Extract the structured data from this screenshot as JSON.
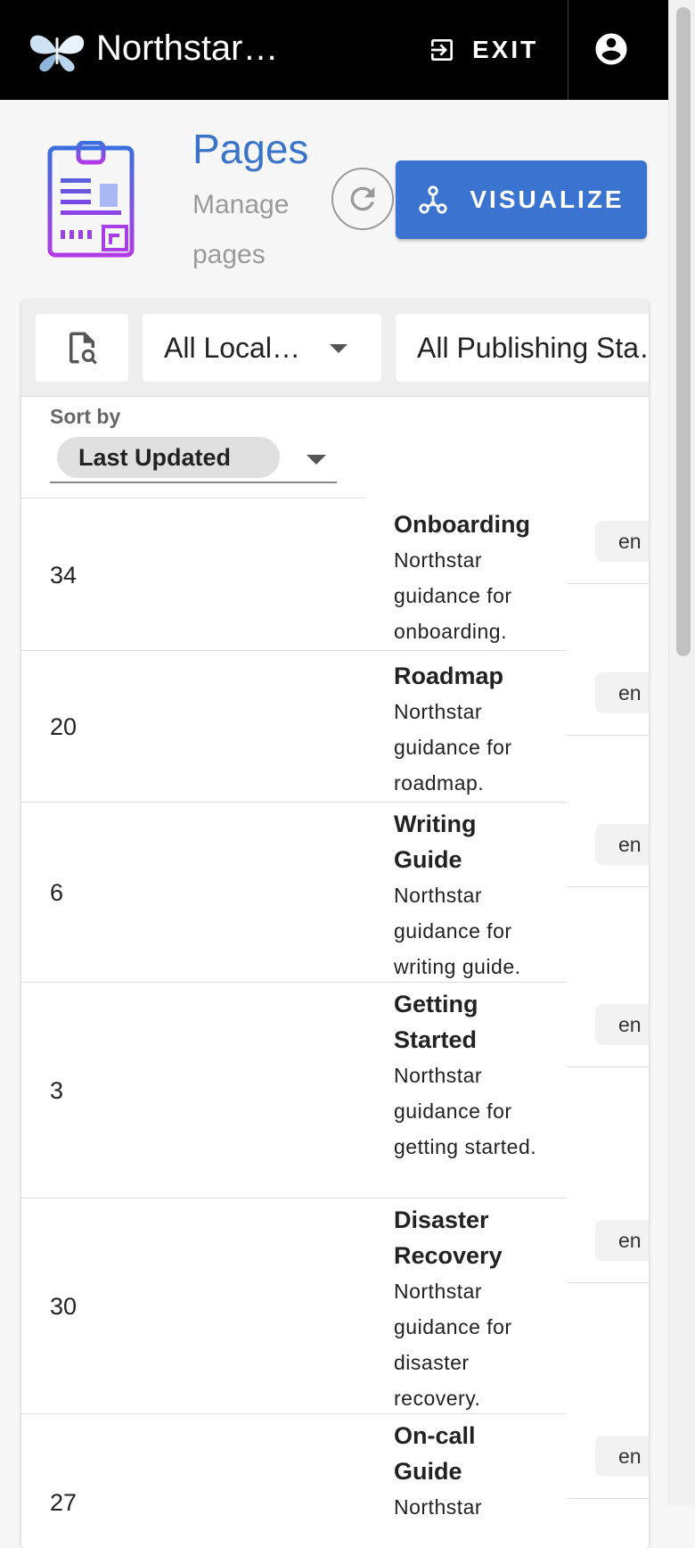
{
  "appbar": {
    "title": "Northstar…",
    "exit_label": "EXIT"
  },
  "header": {
    "title": "Pages",
    "subtitle": "Manage pages",
    "visualize_label": "VISUALIZE"
  },
  "filters": {
    "locale_value": "All Local…",
    "publishing_value": "All Publishing Sta…"
  },
  "sort": {
    "label": "Sort by",
    "value": "Last Updated"
  },
  "rows": [
    {
      "id": "34",
      "title": "Onboarding",
      "description": "Northstar guidance for onboarding.",
      "locale": "en"
    },
    {
      "id": "20",
      "title": "Roadmap",
      "description": "Northstar guidance for roadmap.",
      "locale": "en"
    },
    {
      "id": "6",
      "title": "Writing Guide",
      "description": "Northstar guidance for writing guide.",
      "locale": "en"
    },
    {
      "id": "3",
      "title": "Getting Started",
      "description": "Northstar guidance for getting started.",
      "locale": "en"
    },
    {
      "id": "30",
      "title": "Disaster Recovery",
      "description": "Northstar guidance for disaster recovery.",
      "locale": "en"
    },
    {
      "id": "27",
      "title": "On-call Guide",
      "description": "Northstar",
      "locale": "en"
    }
  ],
  "icons": {
    "logo": "butterfly-logo-icon",
    "exit": "exit-icon",
    "account": "account-circle-icon",
    "page": "clipboard-page-icon",
    "refresh": "refresh-icon",
    "visualize": "graph-nodes-icon",
    "search": "file-search-icon"
  },
  "colors": {
    "appbar_bg": "#000000",
    "accent_blue": "#3a74d0",
    "title_blue": "#3a74c9",
    "icon_purple": "#7a4be8"
  }
}
